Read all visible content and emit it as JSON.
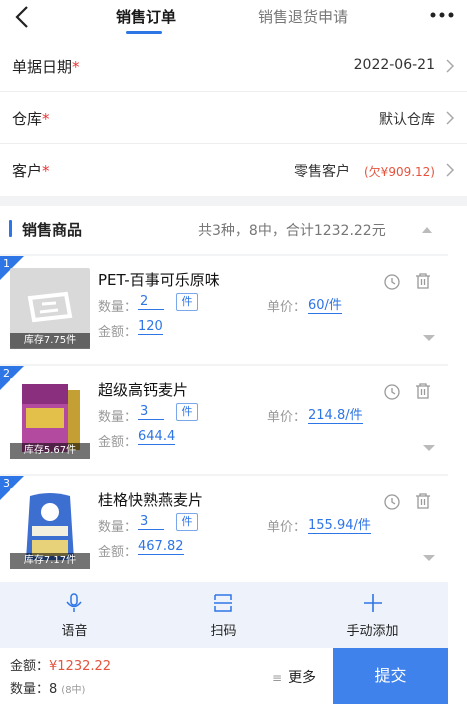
{
  "header": {
    "tabs": [
      {
        "label": "销售订单"
      },
      {
        "label": "销售退货申请"
      }
    ]
  },
  "form": {
    "date": {
      "label": "单据日期",
      "required_mark": "*",
      "value": "2022-06-21"
    },
    "warehouse": {
      "label": "仓库",
      "required_mark": "*",
      "value": "默认仓库"
    },
    "customer": {
      "label": "客户",
      "required_mark": "*",
      "value": "零售客户",
      "debt": "(欠¥909.12)"
    }
  },
  "section": {
    "title": "销售商品",
    "summary": "共3种，8中，合计1232.22元"
  },
  "labels": {
    "qty": "数量：",
    "price": "单价：",
    "amount": "金额："
  },
  "products": [
    {
      "index": "1",
      "name": "PET-百事可乐原味",
      "qty": "2",
      "unit": "件",
      "price": "60/件",
      "amount": "120",
      "stock": "库存7.75件"
    },
    {
      "index": "2",
      "name": "超级高钙麦片",
      "qty": "3",
      "unit": "件",
      "price": "214.8/件",
      "amount": "644.4",
      "stock": "库存5.67件"
    },
    {
      "index": "3",
      "name": "桂格快熟燕麦片",
      "qty": "3",
      "unit": "件",
      "price": "155.94/件",
      "amount": "467.82",
      "stock": "库存7.17件"
    }
  ],
  "actions": {
    "voice": "语音",
    "scan": "扫码",
    "manual_add": "手动添加"
  },
  "footer": {
    "amount_label": "金额：",
    "amount_value": "¥1232.22",
    "qty_label": "数量：",
    "qty_value": "8",
    "qty_sub": "(8中)",
    "more": "更多",
    "submit": "提交"
  },
  "colors": {
    "accent": "#2e75e6",
    "warning": "#e5533d",
    "submit": "#3f82ec"
  },
  "icons": [
    "back-arrow-icon",
    "more-dots-icon",
    "chevron-right-icon",
    "history-icon",
    "trash-icon",
    "chevron-down-icon",
    "microphone-icon",
    "scan-icon",
    "plus-icon",
    "menu-lines-icon"
  ]
}
